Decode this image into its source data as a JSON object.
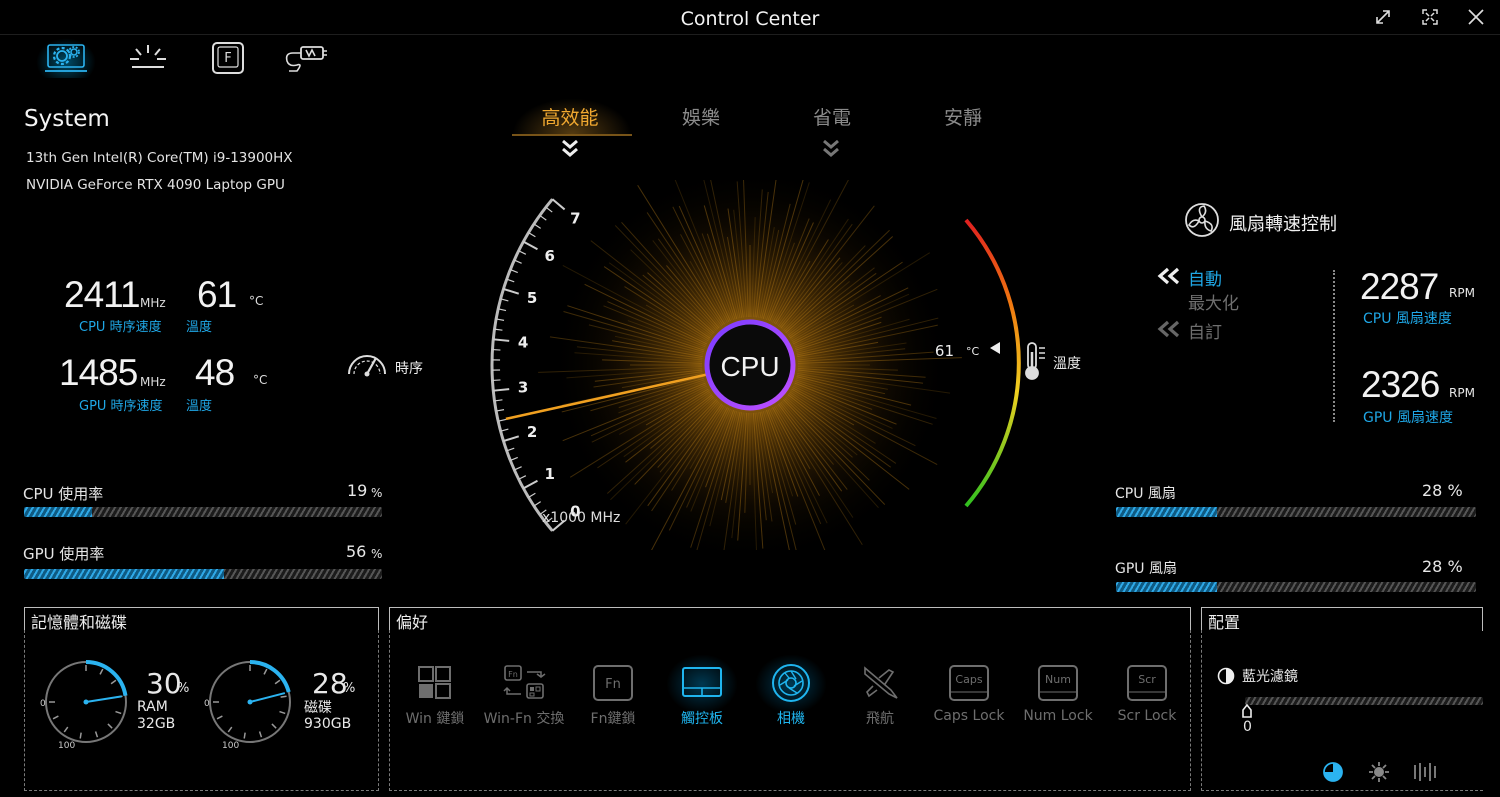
{
  "window": {
    "title": "Control Center"
  },
  "nav": [
    {
      "icon": "system-settings-icon",
      "active": true
    },
    {
      "icon": "brightness-icon",
      "active": false
    },
    {
      "icon": "function-key-icon",
      "active": false
    },
    {
      "icon": "power-plug-icon",
      "active": false
    }
  ],
  "system": {
    "heading": "System",
    "cpu_name": "13th Gen Intel(R) Core(TM) i9-13900HX",
    "gpu_name": "NVIDIA GeForce RTX 4090 Laptop GPU",
    "cpu_clock": "2411",
    "cpu_clock_unit": "MHz",
    "cpu_clock_label": "CPU 時序速度",
    "cpu_temp": "61",
    "cpu_temp_unit": "°C",
    "cpu_temp_label": "溫度",
    "gpu_clock": "1485",
    "gpu_clock_unit": "MHz",
    "gpu_clock_label": "GPU 時序速度",
    "gpu_temp": "48",
    "gpu_temp_unit": "°C",
    "gpu_temp_label": "溫度",
    "clock_button_label": "時序"
  },
  "usage": {
    "cpu_label": "CPU 使用率",
    "cpu_value": "19",
    "cpu_fraction": 0.19,
    "gpu_label": "GPU 使用率",
    "gpu_value": "56",
    "gpu_fraction": 0.56,
    "percent": "%"
  },
  "modes": {
    "items": [
      "高效能",
      "娛樂",
      "省電",
      "安靜"
    ],
    "active_index": 0
  },
  "gauge": {
    "center_label": "CPU",
    "scale_ticks": [
      "0",
      "1",
      "2",
      "3",
      "4",
      "5",
      "6",
      "7"
    ],
    "scale_unit": "x1000 MHz",
    "clock_value_ghz": 2.411,
    "temp_value": "61",
    "temp_unit": "°C",
    "temp_label": "溫度"
  },
  "fan": {
    "heading": "風扇轉速控制",
    "modes": [
      "自動",
      "最大化",
      "自訂"
    ],
    "active_mode": "自動",
    "cpu_rpm": "2287",
    "gpu_rpm": "2326",
    "rpm_unit": "RPM",
    "cpu_rpm_label": "CPU 風扇速度",
    "gpu_rpm_label": "GPU 風扇速度",
    "cpu_fan_label": "CPU 風扇",
    "cpu_fan_value": "28 %",
    "cpu_fan_fraction": 0.28,
    "gpu_fan_label": "GPU 風扇",
    "gpu_fan_value": "28 %",
    "gpu_fan_fraction": 0.28
  },
  "memory": {
    "heading": "記憶體和磁碟",
    "ram_percent": "30",
    "ram_label": "RAM",
    "ram_size": "32GB",
    "ram_fraction": 0.3,
    "disk_percent": "28",
    "disk_label": "磁碟",
    "disk_size": "930GB",
    "disk_fraction": 0.28,
    "pct": "%",
    "dial_min": "0",
    "dial_max": "100"
  },
  "preferences": {
    "heading": "偏好",
    "items": [
      {
        "label": "Win 鍵鎖",
        "icon": "windows-key-icon",
        "on": false
      },
      {
        "label": "Win-Fn 交換",
        "icon": "swap-keys-icon",
        "on": false
      },
      {
        "label": "Fn鍵鎖",
        "icon": "fn-key-icon",
        "on": false,
        "key": "Fn"
      },
      {
        "label": "觸控板",
        "icon": "touchpad-icon",
        "on": true
      },
      {
        "label": "相機",
        "icon": "camera-icon",
        "on": true
      },
      {
        "label": "飛航",
        "icon": "airplane-icon",
        "on": false
      },
      {
        "label": "Caps Lock",
        "icon": "caps-lock-icon",
        "on": false,
        "key": "Caps"
      },
      {
        "label": "Num Lock",
        "icon": "num-lock-icon",
        "on": false,
        "key": "Num"
      },
      {
        "label": "Scr Lock",
        "icon": "scroll-lock-icon",
        "on": false,
        "key": "Scr"
      }
    ]
  },
  "config": {
    "heading": "配置",
    "bluelight_label": "藍光濾鏡",
    "bluelight_value": "0",
    "bluelight_fraction": 0
  },
  "colors": {
    "accent": "#1fa7e6",
    "mode_active": "#f0a830",
    "gauge": "#e8a020"
  }
}
